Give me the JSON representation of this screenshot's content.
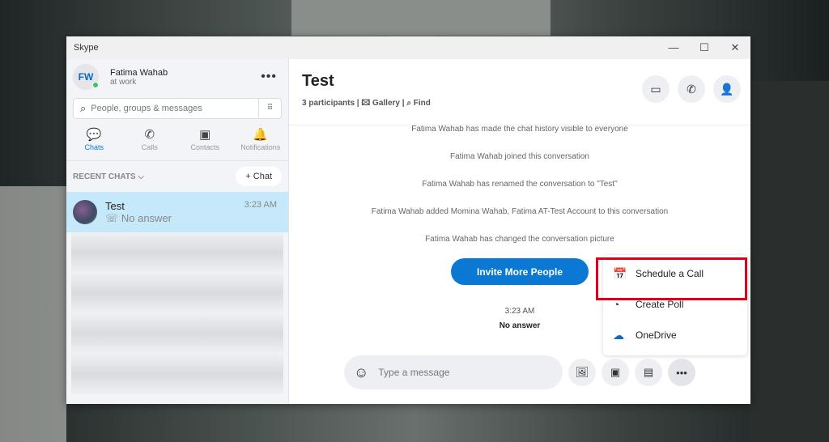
{
  "window": {
    "title": "Skype",
    "controls": [
      "—",
      "☐",
      "✕"
    ]
  },
  "profile": {
    "initials": "FW",
    "name": "Fatima Wahab",
    "status": "at work",
    "more": "•••"
  },
  "search": {
    "placeholder": "People, groups & messages"
  },
  "nav": [
    {
      "label": "Chats",
      "icon": "💬"
    },
    {
      "label": "Calls",
      "icon": "✆"
    },
    {
      "label": "Contacts",
      "icon": "▣"
    },
    {
      "label": "Notifications",
      "icon": "🔔"
    }
  ],
  "recent": {
    "label": "RECENT CHATS ⌵",
    "new_chat": "+ Chat"
  },
  "chats": [
    {
      "name": "Test",
      "status": "☏ No answer",
      "time": "3:23 AM"
    }
  ],
  "conversation": {
    "title": "Test",
    "participants": "3 participants |",
    "gallery": "🖾 Gallery |",
    "find": "⌕ Find",
    "system_messages": [
      "Fatima Wahab has made the chat history visible to everyone",
      "Fatima Wahab joined this conversation",
      "Fatima Wahab has renamed the conversation to \"Test\"",
      "Fatima Wahab added Momina Wahab, Fatima AT-Test Account to this conversation",
      "Fatima Wahab has changed the conversation picture"
    ],
    "invite": "Invite More People",
    "time": "3:23 AM",
    "call_status": "No answer"
  },
  "menu": [
    {
      "label": "Schedule a Call",
      "icon": "📅"
    },
    {
      "label": "Create Poll",
      "icon": "◔"
    },
    {
      "label": "OneDrive",
      "icon": "☁"
    }
  ],
  "composer": {
    "placeholder": "Type a message",
    "emoji": "☺"
  }
}
